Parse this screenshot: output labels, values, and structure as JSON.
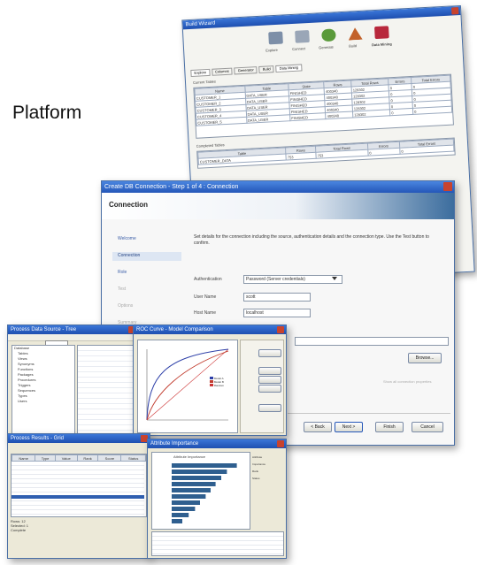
{
  "slide": {
    "heading_partial": "Platform"
  },
  "wizard": {
    "title": "Build Wizard",
    "toolbar": [
      "Explore",
      "Connect",
      "Generate",
      "Build",
      "Data Mining"
    ],
    "tabs": [
      "Explore",
      "Columns",
      "Generator",
      "Build",
      "Data Mining"
    ],
    "section_top": "Current Tables",
    "columns_top": [
      "Name",
      "Table",
      "State",
      "Rows",
      "Total Rows",
      "Errors",
      "Total Errors"
    ],
    "rows_top": [
      [
        "CUSTOMER_1",
        "DATA_USER",
        "FINISHED",
        "400340",
        "128302",
        "0",
        "0"
      ],
      [
        "CUSTOMER_2",
        "DATA_USER",
        "FINISHED",
        "400340",
        "128302",
        "0",
        "0"
      ],
      [
        "CUSTOMER_3",
        "DATA_USER",
        "FINISHED",
        "400340",
        "128302",
        "0",
        "0"
      ],
      [
        "CUSTOMER_4",
        "DATA_USER",
        "FINISHED",
        "400340",
        "128302",
        "0",
        "0"
      ],
      [
        "CUSTOMER_5",
        "DATA_USER",
        "FINISHED",
        "400340",
        "128302",
        "0",
        "0"
      ]
    ],
    "section_bottom": "Completed Tables",
    "columns_bottom": [
      "Table",
      "Rows",
      "Total Rows",
      "Errors",
      "Total Errors"
    ],
    "rows_bottom": [
      [
        "CUSTOMER_DATA",
        "753",
        "753",
        "0",
        "0"
      ]
    ]
  },
  "connection": {
    "title": "Create DB Connection - Step 1 of 4 : Connection",
    "heading": "Connection",
    "steps": [
      "Welcome",
      "Connection",
      "Role",
      "Test",
      "Options",
      "Summary"
    ],
    "description": "Set details for the connection including the source, authentication details and the connection type. Use the Test button to confirm.",
    "fields": [
      {
        "label": "Authentication",
        "value": "Password (Server credentials)"
      },
      {
        "label": "User Name",
        "value": "scott"
      },
      {
        "label": "Host Name",
        "value": "localhost"
      }
    ],
    "side_button": "Browse...",
    "footer_partial": "Show all connection properties",
    "buttons": [
      "< Back",
      "Next >",
      "Finish",
      "Cancel"
    ]
  },
  "explorer": {
    "title": "Process Data Source - Tree",
    "tree": [
      "Database",
      "Tables",
      "Views",
      "Synonyms",
      "Functions",
      "Packages",
      "Procedures",
      "Triggers",
      "Sequences",
      "Types",
      "Users"
    ]
  },
  "roc": {
    "title": "ROC Curve - Model Comparison",
    "legend": [
      "Model A",
      "Model B",
      "Random"
    ]
  },
  "grid": {
    "title": "Process Results - Grid",
    "columns": [
      "Name",
      "Type",
      "Value",
      "Rank",
      "Score",
      "Status"
    ],
    "row_count": 12,
    "status_lines": [
      "Rows: 12",
      "Selected: 1",
      "Complete"
    ]
  },
  "bars": {
    "title": "Attribute Importance",
    "chart_title": "Attribute Importance",
    "values": [
      0.92,
      0.78,
      0.7,
      0.62,
      0.55,
      0.48,
      0.4,
      0.33,
      0.24,
      0.15
    ],
    "side_labels": [
      "Attribute",
      "Importance",
      "Rank",
      "Status"
    ]
  },
  "colors": {
    "titlebar": "#1e4fb0",
    "bar": "#2f5f8f",
    "banner": "#3c6d9e"
  }
}
